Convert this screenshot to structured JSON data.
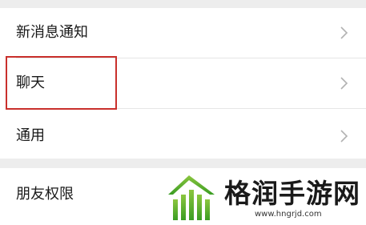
{
  "settings": {
    "items": [
      {
        "label": "新消息通知"
      },
      {
        "label": "聊天"
      },
      {
        "label": "通用"
      },
      {
        "label": "朋友权限"
      }
    ]
  },
  "icons": {
    "chevron": "chevron-right-icon",
    "logo": "hngrjd-logo-icon"
  },
  "colors": {
    "highlight": "#c9302c",
    "background": "#ededed",
    "chevron": "#b2b2b2"
  },
  "watermark": {
    "title": "格润手游网",
    "url": "www.hngrjd.com"
  }
}
